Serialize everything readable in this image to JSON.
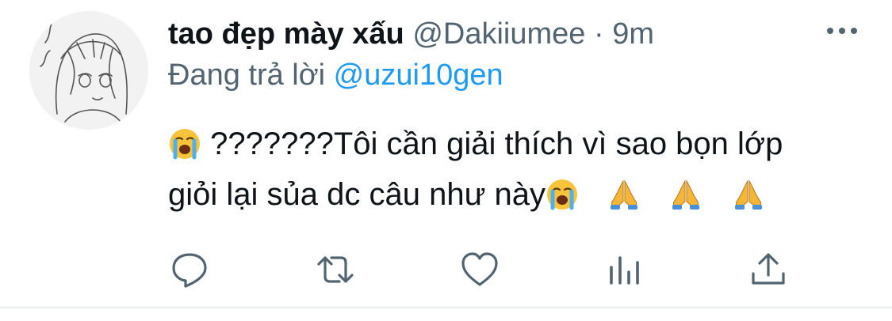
{
  "tweet": {
    "display_name": "tao đẹp mày xấu",
    "handle": "@Dakiiumee",
    "separator": "·",
    "time": "9m",
    "reply_prefix": "Đang trả lời",
    "reply_to": "@uzui10gen",
    "text_line1": "???????Tôi cần giải thích vì sao bọn lớp",
    "text_line2": "giỏi lại sủa dc câu như này",
    "emoji": [
      "loudly-crying-face",
      "loudly-crying-face",
      "folded-hands",
      "folded-hands",
      "folded-hands"
    ]
  },
  "icons": {
    "more": "more-horizontal-icon",
    "reply": "reply-bubble-icon",
    "retweet": "retweet-icon",
    "like": "heart-icon",
    "analytics": "bar-chart-icon",
    "share": "share-upload-icon"
  },
  "colors": {
    "text": "#0f1419",
    "muted": "#536471",
    "link": "#1d9bf0",
    "divider": "#e6ecf0"
  }
}
